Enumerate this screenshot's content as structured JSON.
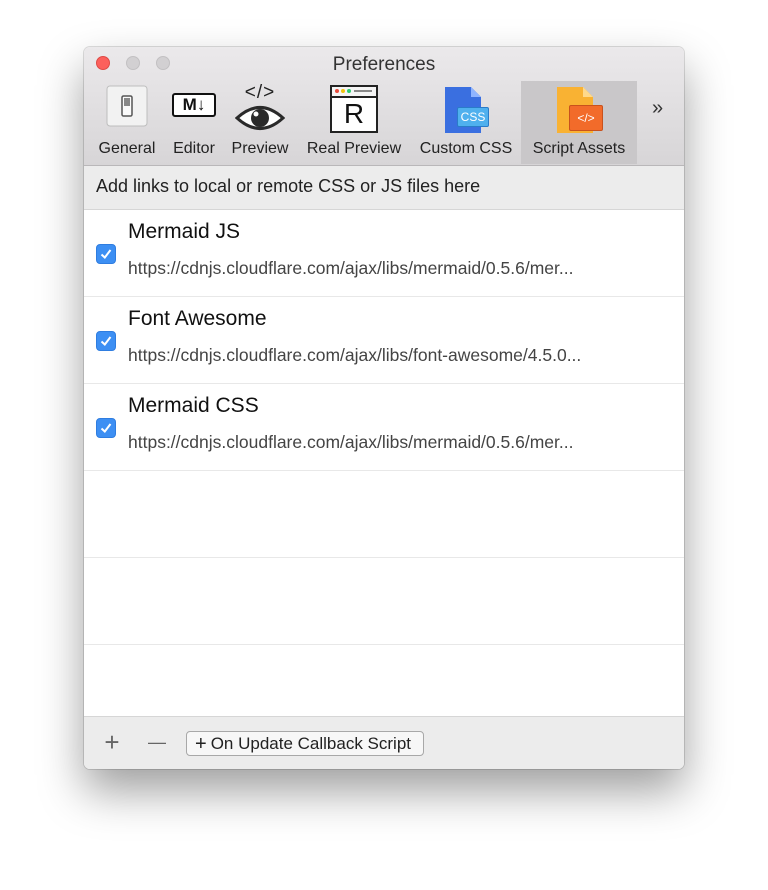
{
  "window": {
    "title": "Preferences"
  },
  "toolbar": {
    "tabs": [
      {
        "label": "General",
        "icon": "toggle-switch-icon",
        "active": false
      },
      {
        "label": "Editor",
        "icon": "markdown-icon",
        "active": false
      },
      {
        "label": "Preview",
        "icon": "eye-icon",
        "active": false
      },
      {
        "label": "Real Preview",
        "icon": "browser-window-icon",
        "active": false
      },
      {
        "label": "Custom CSS",
        "icon": "css-file-icon",
        "active": false
      },
      {
        "label": "Script Assets",
        "icon": "code-file-icon",
        "active": true
      }
    ],
    "overflow": "»",
    "icon_glyphs": {
      "markdown": "M↓",
      "preview_code": "</>",
      "browser_letter": "R",
      "css": "CSS",
      "code": "</>"
    }
  },
  "description": "Add links to local or remote CSS or JS files here",
  "assets": [
    {
      "name": "Mermaid JS",
      "url": "https://cdnjs.cloudflare.com/ajax/libs/mermaid/0.5.6/mer...",
      "checked": true
    },
    {
      "name": "Font Awesome",
      "url": "https://cdnjs.cloudflare.com/ajax/libs/font-awesome/4.5.0...",
      "checked": true
    },
    {
      "name": "Mermaid CSS",
      "url": "https://cdnjs.cloudflare.com/ajax/libs/mermaid/0.5.6/mer...",
      "checked": true
    }
  ],
  "footer": {
    "add": "+",
    "remove": "—",
    "callback_plus": "+",
    "callback_label": "On Update Callback Script"
  },
  "colors": {
    "accent": "#3d8ff3",
    "active_tab": "#c9c7c9",
    "close": "#fc605c",
    "css_icon": "#3a7fe0",
    "code_icon": "#f58a2a"
  }
}
